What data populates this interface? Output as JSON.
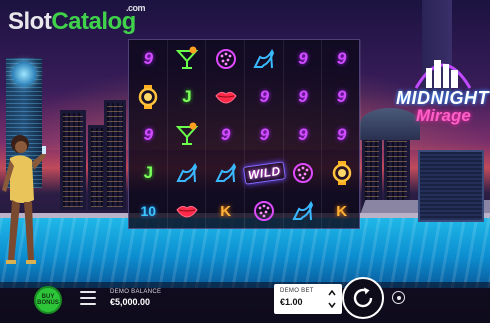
{
  "site_logo": {
    "part1": "Slot",
    "part2": "Catalog",
    "suffix": ".com"
  },
  "game_logo": {
    "line1": "MIDNIGHT",
    "line2": "Mirage"
  },
  "reels": [
    [
      "purple-9-icon",
      "neon-watch-icon",
      "purple-9-icon",
      "green-j-icon",
      "blue-10-icon"
    ],
    [
      "cocktail-icon",
      "green-j-icon",
      "cocktail-icon",
      "high-heel-icon",
      "lips-icon"
    ],
    [
      "disco-ball-icon",
      "lips-icon",
      "purple-9-icon",
      "high-heel-icon",
      "orange-k-icon"
    ],
    [
      "high-heel-icon",
      "purple-9-icon",
      "purple-9-icon",
      "wild-icon",
      "disco-ball-icon"
    ],
    [
      "purple-9-icon",
      "purple-9-icon",
      "purple-9-icon",
      "disco-ball-icon",
      "high-heel-icon"
    ],
    [
      "purple-9-icon",
      "purple-9-icon",
      "purple-9-icon",
      "neon-watch-icon",
      "orange-k-icon"
    ]
  ],
  "symbol_text": {
    "nine": "9",
    "jay": "J",
    "kay": "K",
    "ten": "10",
    "wild": "WILD"
  },
  "buy_bonus": {
    "line1": "BUY",
    "line2": "BONUS"
  },
  "balance": {
    "label": "DEMO BALANCE",
    "value": "€5,000.00"
  },
  "bet": {
    "label": "DEMO BET",
    "value": "€1.00"
  },
  "colors": {
    "logo_green": "#3fd24a",
    "buy_bonus": "#2ec43a",
    "pool": "#1fb8e8",
    "neon_purple": "#d04dff",
    "neon_pink": "#ff5fc8"
  }
}
